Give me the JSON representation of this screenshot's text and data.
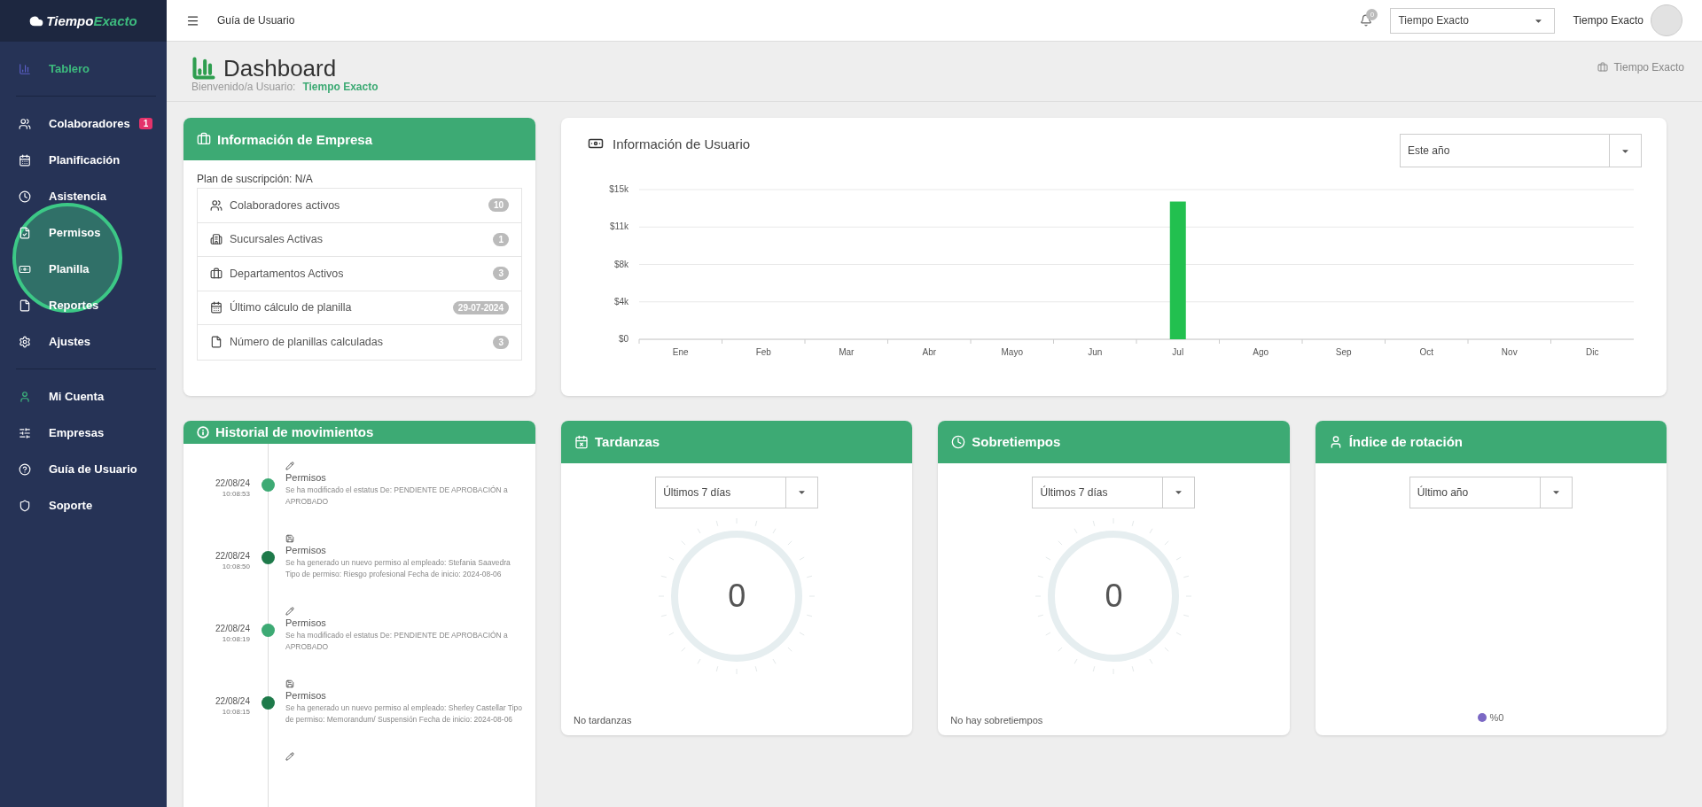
{
  "logo": {
    "part_1": "Tiempo",
    "part_2": "Exacto"
  },
  "sidebar": {
    "sections": [
      [
        {
          "kind": "chart",
          "label": "Tablero",
          "selected": true
        }
      ],
      [
        {
          "kind": "users",
          "label": "Colaboradores",
          "selected": false,
          "badge": "1"
        },
        {
          "kind": "calendar",
          "label": "Planificación",
          "selected": false
        },
        {
          "kind": "clock",
          "label": "Asistencia",
          "selected": false
        },
        {
          "kind": "permit",
          "label": "Permisos",
          "selected": false
        },
        {
          "kind": "money",
          "label": "Planilla",
          "selected": false
        },
        {
          "kind": "file",
          "label": "Reportes",
          "selected": false
        },
        {
          "kind": "gear",
          "label": "Ajustes",
          "selected": false
        }
      ],
      [
        {
          "kind": "user",
          "label": "Mi Cuenta",
          "selected": false
        },
        {
          "kind": "sliders",
          "label": "Empresas",
          "selected": false
        },
        {
          "kind": "help",
          "label": "Guía de Usuario",
          "selected": false
        },
        {
          "kind": "shield",
          "label": "Soporte",
          "selected": false
        }
      ]
    ],
    "click_highlight": true
  },
  "topbar": {
    "link": "Guía de Usuario",
    "notification_count": "0",
    "company_select": "Tiempo Exacto",
    "user_name": "Tiempo Exacto"
  },
  "page_header": {
    "title": "Dashboard",
    "welcome_label": "Bienvenido/a Usuario:",
    "welcome_name": "Tiempo Exacto",
    "breadcrumb": "Tiempo Exacto"
  },
  "company_card": {
    "title": "Información de Empresa",
    "plan": "Plan de suscripción: N/A",
    "items": [
      {
        "kind": "users",
        "label": "Colaboradores activos",
        "count": "10"
      },
      {
        "kind": "building",
        "label": "Sucursales Activas",
        "count": "1"
      },
      {
        "kind": "briefcase",
        "label": "Departamentos Activos",
        "count": "3"
      },
      {
        "kind": "calendar",
        "label": "Último cálculo de planilla",
        "count": "29-07-2024"
      },
      {
        "kind": "file",
        "label": "Número de planillas calculadas",
        "count": "3"
      }
    ]
  },
  "user_chart_card": {
    "title": "Información de Usuario",
    "period_select": "Este año",
    "chart_data": {
      "type": "bar",
      "categories": [
        "Ene",
        "Feb",
        "Mar",
        "Abr",
        "Mayo",
        "Jun",
        "Jul",
        "Ago",
        "Sep",
        "Oct",
        "Nov",
        "Dic"
      ],
      "values": [
        0,
        0,
        0,
        0,
        0,
        0,
        13800,
        0,
        0,
        0,
        0,
        0
      ],
      "ylim": [
        0,
        15000
      ],
      "grid": true,
      "yticks": [
        {
          "value": 0,
          "label": "$0"
        },
        {
          "value": 3750,
          "label": "$4k"
        },
        {
          "value": 7500,
          "label": "$8k"
        },
        {
          "value": 11250,
          "label": "$11k"
        },
        {
          "value": 15000,
          "label": "$15k"
        }
      ]
    }
  },
  "history_card": {
    "title": "Historial de movimientos",
    "entries": [
      {
        "date": "22/08/24",
        "time": "10:08:53",
        "kind": "edit",
        "color": "#3daa74",
        "title": "Permisos",
        "text": "Se ha modificado el estatus De: PENDIENTE DE APROBACIÓN a APROBADO"
      },
      {
        "date": "22/08/24",
        "time": "10:08:50",
        "kind": "save",
        "color": "#1e7a4a",
        "title": "Permisos",
        "text": "Se ha generado un nuevo permiso al empleado: Stefania Saavedra Tipo de permiso: Riesgo profesional Fecha de inicio: 2024-08-06"
      },
      {
        "date": "22/08/24",
        "time": "10:08:19",
        "kind": "edit",
        "color": "#3daa74",
        "title": "Permisos",
        "text": "Se ha modificado el estatus De: PENDIENTE DE APROBACIÓN a APROBADO"
      },
      {
        "date": "22/08/24",
        "time": "10:08:15",
        "kind": "save",
        "color": "#1e7a4a",
        "title": "Permisos",
        "text": "Se ha generado un nuevo permiso al empleado: Sherley Castellar Tipo de permiso: Memorandum/ Suspensión Fecha de inicio: 2024-08-06"
      },
      {
        "kind": "edit"
      }
    ]
  },
  "stat_cards": [
    {
      "kind": "gauge",
      "title": "Tardanzas",
      "period_select": "Últimos 7 días",
      "value": "0",
      "footer": "No tardanzas"
    },
    {
      "kind": "gauge",
      "title": "Sobretiempos",
      "period_select": "Últimos 7 días",
      "value": "0",
      "footer": "No hay sobretiempos"
    },
    {
      "kind": "legend",
      "title": "Índice de rotación",
      "period_select": "Último año",
      "legend": "%0",
      "color": "#7b68c4"
    }
  ]
}
